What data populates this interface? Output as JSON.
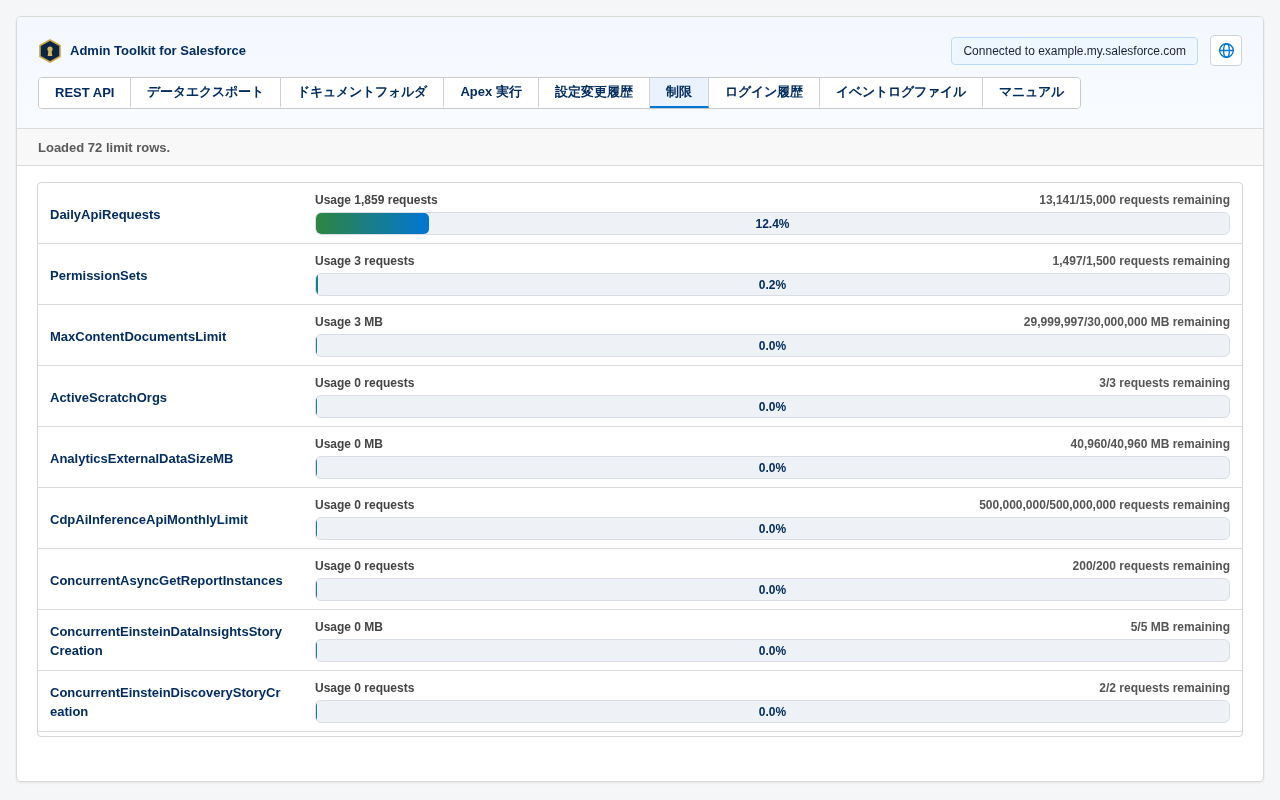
{
  "header": {
    "title": "Admin Toolkit for Salesforce",
    "connection": "Connected to example.my.salesforce.com"
  },
  "tabs": [
    {
      "label": "REST API",
      "selected": false
    },
    {
      "label": "データエクスポート",
      "selected": false
    },
    {
      "label": "ドキュメントフォルダ",
      "selected": false
    },
    {
      "label": "Apex 実行",
      "selected": false
    },
    {
      "label": "設定変更履歴",
      "selected": false
    },
    {
      "label": "制限",
      "selected": true
    },
    {
      "label": "ログイン履歴",
      "selected": false
    },
    {
      "label": "イベントログファイル",
      "selected": false
    },
    {
      "label": "マニュアル",
      "selected": false
    }
  ],
  "status_bar": {
    "message": "Loaded 72 limit rows."
  },
  "limits": [
    {
      "name": "DailyApiRequests",
      "usage": "Usage 1,859 requests",
      "remaining": "13,141/15,000 requests remaining",
      "level": 0.124,
      "percent": "12.4%"
    },
    {
      "name": "PermissionSets",
      "usage": "Usage 3 requests",
      "remaining": "1,497/1,500 requests remaining",
      "level": 0.002,
      "percent": "0.2%"
    },
    {
      "name": "MaxContentDocumentsLimit",
      "usage": "Usage 3 MB",
      "remaining": "29,999,997/30,000,000 MB remaining",
      "level": 0,
      "percent": "0.0%"
    },
    {
      "name": "ActiveScratchOrgs",
      "usage": "Usage 0 requests",
      "remaining": "3/3 requests remaining",
      "level": 0,
      "percent": "0.0%"
    },
    {
      "name": "AnalyticsExternalDataSizeMB",
      "usage": "Usage 0 MB",
      "remaining": "40,960/40,960 MB remaining",
      "level": 0,
      "percent": "0.0%"
    },
    {
      "name": "CdpAiInferenceApiMonthlyLimit",
      "usage": "Usage 0 requests",
      "remaining": "500,000,000/500,000,000 requests remaining",
      "level": 0,
      "percent": "0.0%"
    },
    {
      "name": "ConcurrentAsyncGetReportInstances",
      "usage": "Usage 0 requests",
      "remaining": "200/200 requests remaining",
      "level": 0,
      "percent": "0.0%"
    },
    {
      "name": "ConcurrentEinsteinDataInsightsStoryCreation",
      "usage": "Usage 0 MB",
      "remaining": "5/5 MB remaining",
      "level": 0,
      "percent": "0.0%"
    },
    {
      "name": "ConcurrentEinsteinDiscoveryStoryCreation",
      "usage": "Usage 0 requests",
      "remaining": "2/2 requests remaining",
      "level": 0,
      "percent": "0.0%"
    }
  ]
}
